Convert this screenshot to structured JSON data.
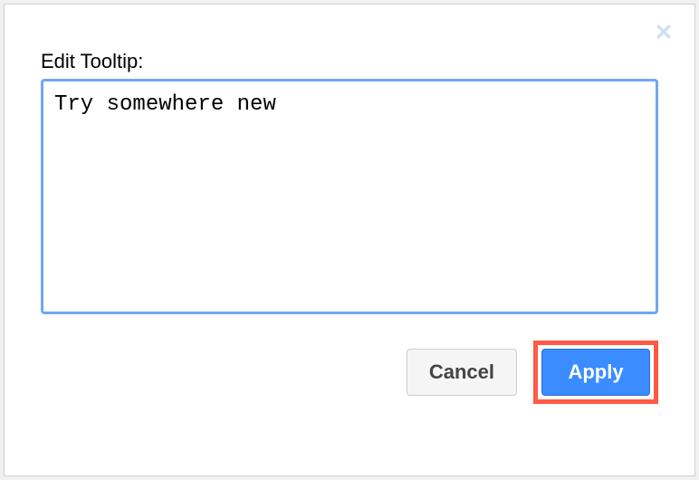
{
  "dialog": {
    "label": "Edit Tooltip:",
    "textarea_value": "Try somewhere new",
    "cancel_label": "Cancel",
    "apply_label": "Apply"
  }
}
